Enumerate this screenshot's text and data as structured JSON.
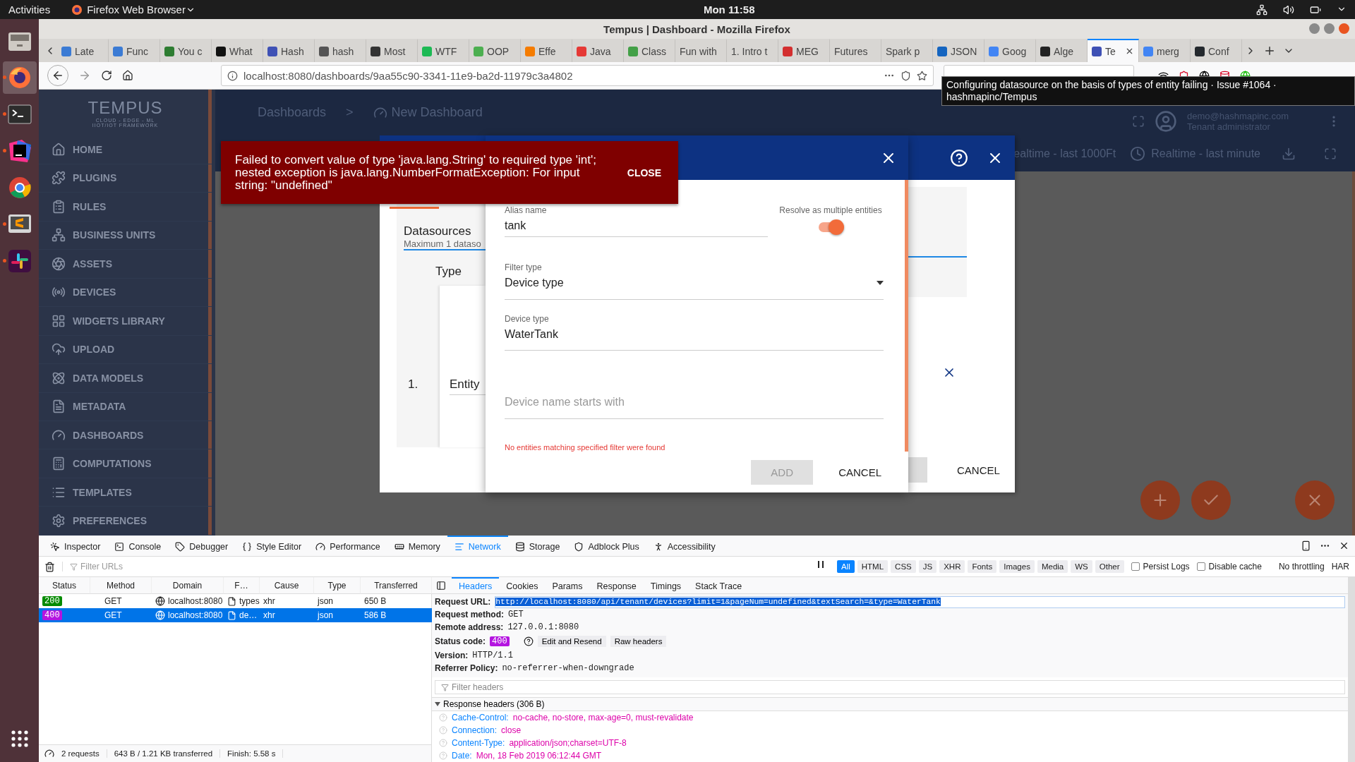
{
  "desktop_bar": {
    "activities": "Activities",
    "app_menu": "Firefox Web Browser",
    "clock": "Mon 11:58"
  },
  "dock": [
    {
      "kind": "files",
      "selected": false,
      "running": false
    },
    {
      "kind": "firefox",
      "selected": true,
      "running": true
    },
    {
      "kind": "terminal",
      "selected": false,
      "running": true
    },
    {
      "kind": "intellij",
      "selected": false,
      "running": true
    },
    {
      "kind": "chrome",
      "selected": false,
      "running": false
    },
    {
      "kind": "sublime",
      "selected": false,
      "running": true
    },
    {
      "kind": "slack",
      "selected": false,
      "running": true
    },
    {
      "kind": "apps",
      "selected": false,
      "running": false
    }
  ],
  "browser": {
    "title": "Tempus | Dashboard - Mozilla Firefox",
    "tabs": [
      {
        "label": "Late",
        "color": "#3b7bd4",
        "selected": false
      },
      {
        "label": "Func",
        "color": "#3b7bd4",
        "selected": false
      },
      {
        "label": "You c",
        "color": "#2e7d32",
        "selected": false
      },
      {
        "label": "What",
        "color": "#111111",
        "selected": false
      },
      {
        "label": "Hash",
        "color": "#3f51b5",
        "selected": false
      },
      {
        "label": "hash",
        "color": "#555555",
        "selected": false
      },
      {
        "label": "Most",
        "color": "#333333",
        "selected": false
      },
      {
        "label": "WTF",
        "color": "#1db954",
        "selected": false
      },
      {
        "label": "OOP",
        "color": "#4caf50",
        "selected": false
      },
      {
        "label": "Effe",
        "color": "#f57c00",
        "selected": false
      },
      {
        "label": "Java",
        "color": "#e53935",
        "selected": false
      },
      {
        "label": "Class",
        "color": "#43a047",
        "selected": false
      },
      {
        "label": "Fun with",
        "selected": false
      },
      {
        "label": "1. Intro t",
        "selected": false
      },
      {
        "label": "MEG",
        "color": "#d32f2f",
        "selected": false
      },
      {
        "label": "Futures",
        "selected": false
      },
      {
        "label": "Spark p",
        "selected": false
      },
      {
        "label": "JSON",
        "color": "#1565c0",
        "selected": false
      },
      {
        "label": "Goog",
        "color": "#4285f4",
        "selected": false
      },
      {
        "label": "Alge",
        "color": "#222222",
        "selected": false
      },
      {
        "label": "Te",
        "color": "#3f51b5",
        "selected": true
      },
      {
        "label": "merg",
        "color": "#4285f4",
        "selected": false
      },
      {
        "label": "Conf",
        "color": "#24292e",
        "selected": false
      }
    ],
    "url": "localhost:8080/dashboards/9aa55c90-3341-11e9-ba2d-11979c3a4802",
    "tooltip": "Configuring datasource on the basis of types of entity failing · Issue #1064 · hashmapinc/Tempus"
  },
  "app": {
    "logo": {
      "name": "TEMPUS",
      "tagline": "CLOUD - EDGE - ML",
      "subtitle": "IIOT/IOT FRAMEWORK"
    },
    "sidebar": [
      "HOME",
      "PLUGINS",
      "RULES",
      "BUSINESS UNITS",
      "ASSETS",
      "DEVICES",
      "WIDGETS LIBRARY",
      "UPLOAD",
      "DATA MODELS",
      "METADATA",
      "DASHBOARDS",
      "COMPUTATIONS",
      "TEMPLATES",
      "PREFERENCES"
    ],
    "breadcrumb": {
      "parent": "Dashboards",
      "separator": ">",
      "current": "New Dashboard"
    },
    "user": {
      "email": "demo@hashmapinc.com",
      "role": "Tenant administrator"
    },
    "timewindows": [
      "ealtime - last 1000Ft",
      "Realtime - last minute"
    ]
  },
  "error_toast": {
    "message": "Failed to convert value of type 'java.lang.String' to required type 'int'; nested exception is java.lang.NumberFormatException: For input string: \"undefined\"",
    "action": "CLOSE"
  },
  "datasource_dialog": {
    "section": "Datasources",
    "hint": "Maximum 1 dataso",
    "type_label": "Type",
    "row_index": "1.",
    "row_type": "Entity",
    "cancel": "CANCEL"
  },
  "alias_dialog": {
    "alias": {
      "label": "Alias name",
      "value": "tank"
    },
    "resolve_multiple": {
      "label": "Resolve as multiple entities",
      "on": true
    },
    "fields": [
      {
        "kind": "select",
        "label": "Filter type",
        "value": "Device type"
      },
      {
        "kind": "text",
        "label": "Device type",
        "value": "WaterTank"
      },
      {
        "kind": "text",
        "placeholder": "Device name starts with"
      }
    ],
    "error": "No entities matching specified filter were found",
    "buttons": [
      {
        "label": "ADD",
        "disabled": true
      },
      {
        "label": "CANCEL",
        "disabled": false
      }
    ]
  },
  "devtools": {
    "tabs": [
      {
        "label": "Inspector",
        "selected": false
      },
      {
        "label": "Console",
        "selected": false
      },
      {
        "label": "Debugger",
        "selected": false
      },
      {
        "label": "Style Editor",
        "selected": false
      },
      {
        "label": "Performance",
        "selected": false
      },
      {
        "label": "Memory",
        "selected": false
      },
      {
        "label": "Network",
        "selected": true
      },
      {
        "label": "Storage",
        "selected": false
      },
      {
        "label": "Adblock Plus",
        "selected": false
      },
      {
        "label": "Accessibility",
        "selected": false
      }
    ],
    "filter_placeholder": "Filter URLs",
    "type_filters": [
      {
        "label": "All",
        "selected": true
      },
      {
        "label": "HTML",
        "selected": false
      },
      {
        "label": "CSS",
        "selected": false
      },
      {
        "label": "JS",
        "selected": false
      },
      {
        "label": "XHR",
        "selected": false
      },
      {
        "label": "Fonts",
        "selected": false
      },
      {
        "label": "Images",
        "selected": false
      },
      {
        "label": "Media",
        "selected": false
      },
      {
        "label": "WS",
        "selected": false
      },
      {
        "label": "Other",
        "selected": false
      }
    ],
    "options": [
      {
        "label": "Persist Logs",
        "checked": false
      },
      {
        "label": "Disable cache",
        "checked": false
      }
    ],
    "throttling": "No throttling",
    "har": "HAR",
    "columns": [
      "Status",
      "Method",
      "Domain",
      "F…",
      "Cause",
      "Type",
      "Transferred"
    ],
    "requests": [
      {
        "status": "200",
        "color": "#058b00",
        "method": "GET",
        "domain": "localhost:8080",
        "file": "types",
        "cause": "xhr",
        "type": "json",
        "transferred": "650 B",
        "selected": false
      },
      {
        "status": "400",
        "color": "#b414e0",
        "method": "GET",
        "domain": "localhost:8080",
        "file": "de…",
        "cause": "xhr",
        "type": "json",
        "transferred": "586 B",
        "selected": true
      }
    ],
    "detail_tabs": [
      {
        "label": "Headers",
        "selected": true
      },
      {
        "label": "Cookies",
        "selected": false
      },
      {
        "label": "Params",
        "selected": false
      },
      {
        "label": "Response",
        "selected": false
      },
      {
        "label": "Timings",
        "selected": false
      },
      {
        "label": "Stack Trace",
        "selected": false
      }
    ],
    "request_url": {
      "label": "Request URL:",
      "value": "http://localhost:8080/api/tenant/devices?limit=1&pageNum=undefined&textSearch=&type=WaterTank"
    },
    "summary_top": [
      {
        "label": "Request method:",
        "value": "GET"
      },
      {
        "label": "Remote address:",
        "value": "127.0.0.1:8080"
      }
    ],
    "status_code": {
      "label": "Status code:",
      "value": "400",
      "color": "#b414e0"
    },
    "actions": [
      "Edit and Resend",
      "Raw headers"
    ],
    "summary_bottom": [
      {
        "label": "Version:",
        "value": "HTTP/1.1"
      },
      {
        "label": "Referrer Policy:",
        "value": "no-referrer-when-downgrade"
      }
    ],
    "filter_headers_placeholder": "Filter headers",
    "response_headers": {
      "title": "Response headers (306 B)",
      "expanded": true,
      "items": [
        {
          "name": "Cache-Control:",
          "value": "no-cache, no-store, max-age=0, must-revalidate"
        },
        {
          "name": "Connection:",
          "value": "close"
        },
        {
          "name": "Content-Type:",
          "value": "application/json;charset=UTF-8"
        },
        {
          "name": "Date:",
          "value": "Mon, 18 Feb 2019 06:12:44 GMT"
        }
      ]
    },
    "status_bar": [
      "2 requests",
      "643 B / 1.21 KB transferred",
      "Finish: 5.58 s"
    ]
  }
}
